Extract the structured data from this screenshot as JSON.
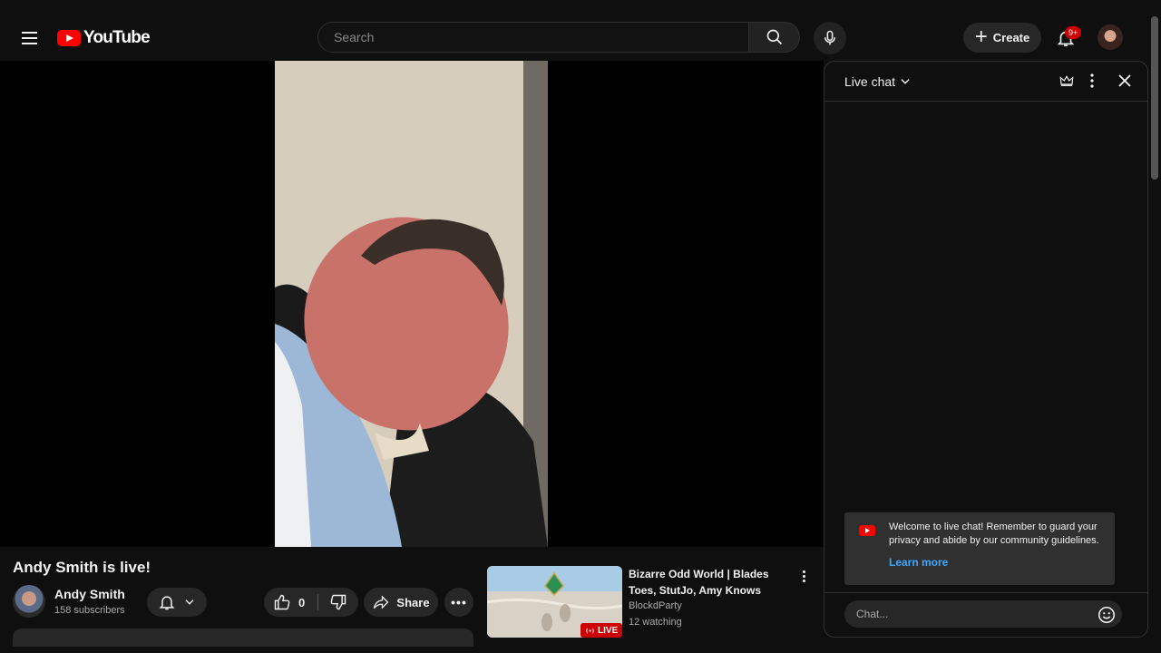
{
  "header": {
    "logo_text": "YouTube",
    "search_placeholder": "Search",
    "create_label": "Create",
    "notification_count": "9+"
  },
  "video": {
    "title": "Andy Smith is live!",
    "channel_name": "Andy Smith",
    "subscribers": "158 subscribers",
    "like_count": "0",
    "share_label": "Share"
  },
  "recommendation": {
    "title": "Bizarre Odd World | Blades Toes, StutJo, Amy Knows",
    "channel": "BlockdParty",
    "watching": "12 watching",
    "live_label": "LIVE"
  },
  "chat": {
    "title": "Live chat",
    "welcome_text": "Welcome to live chat! Remember to guard your privacy and abide by our community guidelines.",
    "learn_more": "Learn more",
    "input_placeholder": "Chat..."
  },
  "colors": {
    "background": "#0f0f0f",
    "accent_red": "#ff0000",
    "live_red": "#cc0000",
    "link_blue": "#3ea6ff",
    "chip_bg": "#272727"
  }
}
